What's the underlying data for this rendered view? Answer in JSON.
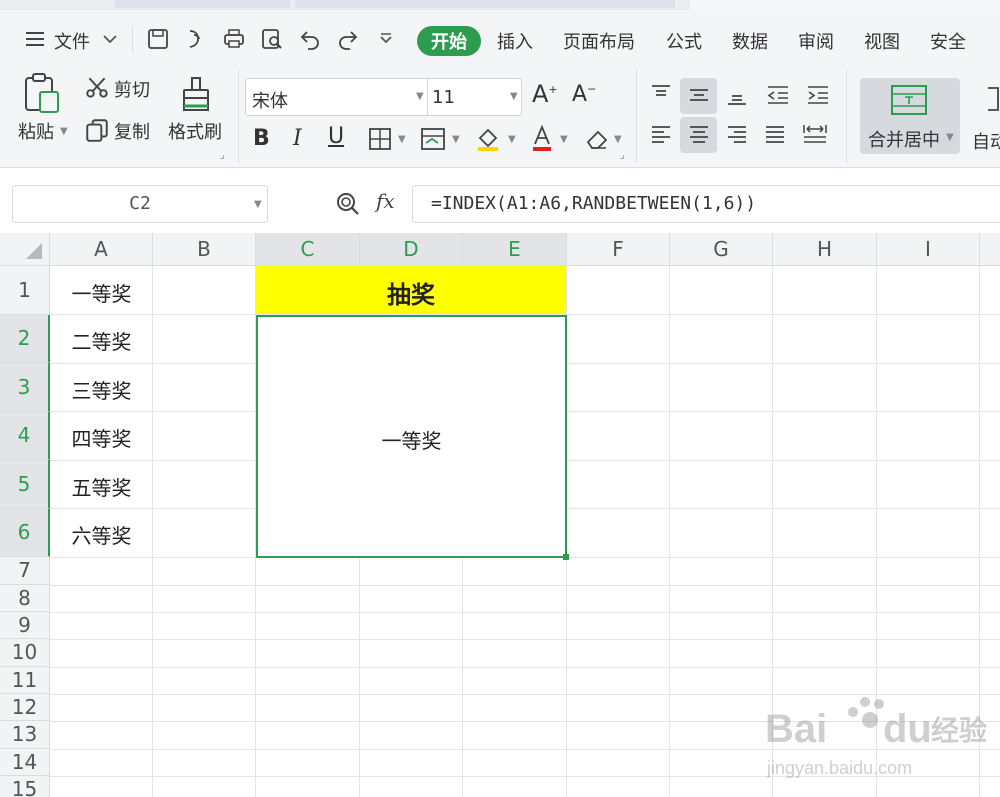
{
  "menu": {
    "file": "文件",
    "tabs": [
      "开始",
      "插入",
      "页面布局",
      "公式",
      "数据",
      "审阅",
      "视图",
      "安全"
    ],
    "active": "开始"
  },
  "ribbon": {
    "paste": "粘贴",
    "cut": "剪切",
    "copy": "复制",
    "format_painter": "格式刷",
    "font_name": "宋体",
    "font_size": "11",
    "merge_center": "合并居中",
    "auto_wrap": "自动"
  },
  "formula_bar": {
    "name_box": "C2",
    "fx": "fx",
    "formula": "=INDEX(A1:A6,RANDBETWEEN(1,6))"
  },
  "sheet": {
    "columns": [
      "A",
      "B",
      "C",
      "D",
      "E",
      "F",
      "G",
      "H",
      "I"
    ],
    "rows": [
      "1",
      "2",
      "3",
      "4",
      "5",
      "6",
      "7",
      "8",
      "9",
      "10",
      "11",
      "12",
      "13",
      "14",
      "15"
    ],
    "a_values": [
      "一等奖",
      "二等奖",
      "三等奖",
      "四等奖",
      "五等奖",
      "六等奖"
    ],
    "title": "抽奖",
    "result": "一等奖"
  },
  "colors": {
    "accent": "#2e9c4f",
    "highlight": "#ffff00"
  },
  "watermark": {
    "brand": "Bai du 经验",
    "url": "jingyan.baidu.com"
  }
}
